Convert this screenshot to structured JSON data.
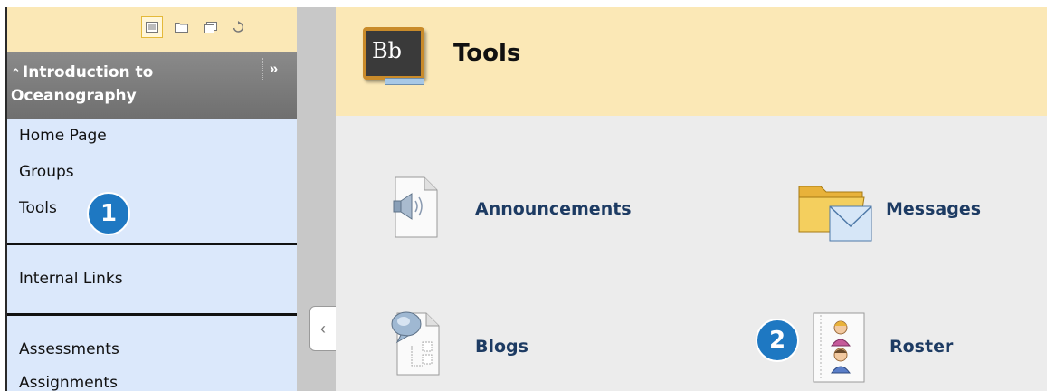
{
  "sidebar": {
    "course_title": "Introduction to Oceanography",
    "collapse_symbol": "»",
    "toolbar": [
      "list-view-icon",
      "folder-view-icon",
      "window-view-icon",
      "refresh-icon"
    ],
    "items": [
      {
        "label": "Home Page"
      },
      {
        "label": "Groups"
      },
      {
        "label": "Tools"
      },
      {
        "label": "Internal Links"
      },
      {
        "label": "Assessments"
      },
      {
        "label": "Assignments"
      }
    ]
  },
  "callouts": {
    "one": "1",
    "two": "2"
  },
  "main": {
    "logo_text": "Bb",
    "page_title": "Tools",
    "tools": [
      {
        "label": "Announcements",
        "icon": "speaker-document-icon"
      },
      {
        "label": "Messages",
        "icon": "folder-envelope-icon"
      },
      {
        "label": "Blogs",
        "icon": "blog-document-icon"
      },
      {
        "label": "Roster",
        "icon": "roster-people-icon"
      }
    ]
  },
  "colors": {
    "header_bg": "#fbe8b6",
    "sidebar_bg": "#dbe8fb",
    "link": "#1d3b63",
    "badge": "#1e78c2",
    "course_header": "#777777"
  }
}
